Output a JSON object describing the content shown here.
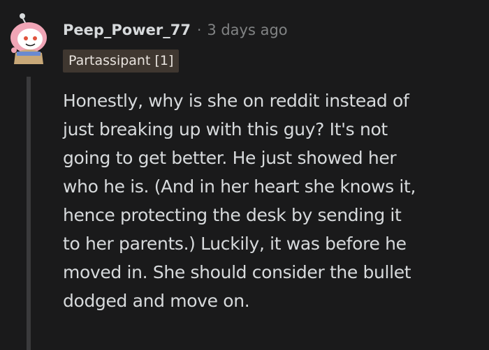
{
  "comment": {
    "author": "Peep_Power_77",
    "separator": "·",
    "timestamp": "3 days ago",
    "flair": "Partassipant [1]",
    "body_lines": [
      "Honestly, why is she on reddit instead of",
      "just breaking up with this guy? It's not",
      "going to get better. He just showed her",
      "who he is. (And in her heart she knows it,",
      "hence protecting the desk by sending it",
      "to her parents.) Luckily, it was before he",
      "moved in. She should consider the bullet",
      "dodged and move on."
    ]
  },
  "colors": {
    "background": "#1a1a1b",
    "text": "#d7dadc",
    "muted": "#818384",
    "flair_bg": "#3f3730",
    "thread_line": "#3a3a3c",
    "avatar_accent": "#f4a7b9"
  },
  "icons": {
    "avatar": "snoo-avatar-icon"
  }
}
